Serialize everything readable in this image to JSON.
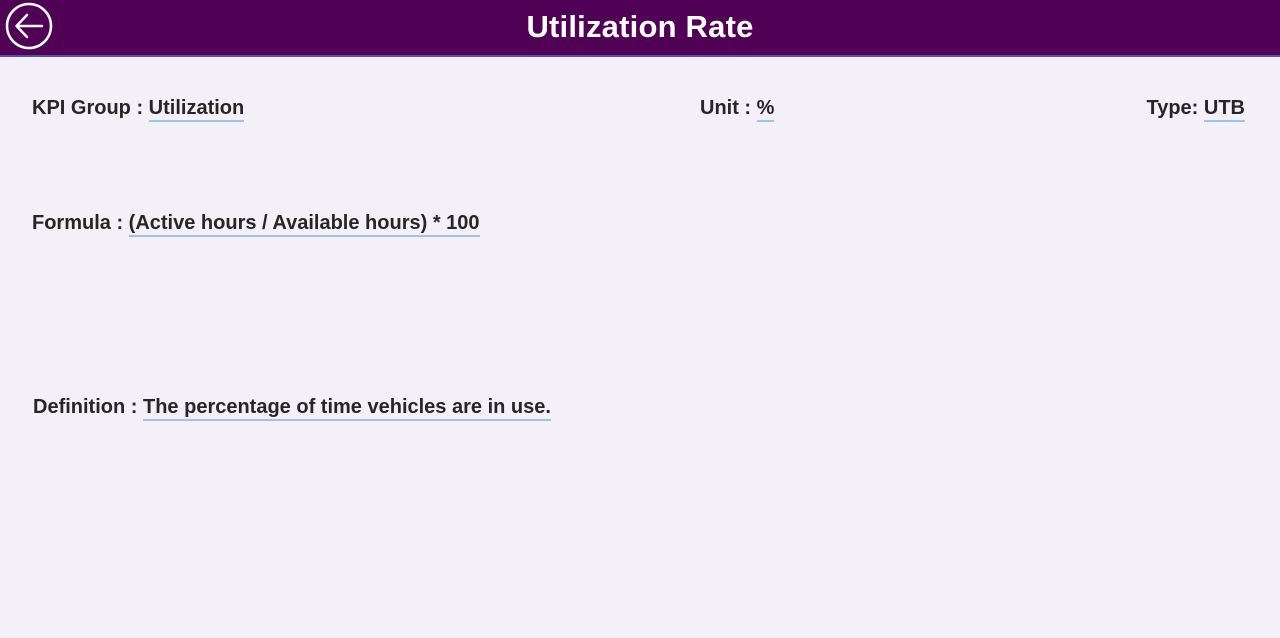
{
  "header": {
    "title": "Utilization Rate",
    "back_icon": "arrow-left-circle-icon",
    "background_color": "#500055"
  },
  "kpi": {
    "group_label": "KPI Group : ",
    "group_value": "Utilization",
    "unit_label": "Unit : ",
    "unit_value": "%",
    "type_label": "Type: ",
    "type_value": "UTB",
    "formula_label": "Formula : ",
    "formula_value": "(Active hours / Available hours) * 100",
    "definition_label": "Definition : ",
    "definition_value": "The percentage of time vehicles are in use."
  },
  "colors": {
    "page_background": "#f4f0f7",
    "value_underline": "#9cc4ea"
  }
}
